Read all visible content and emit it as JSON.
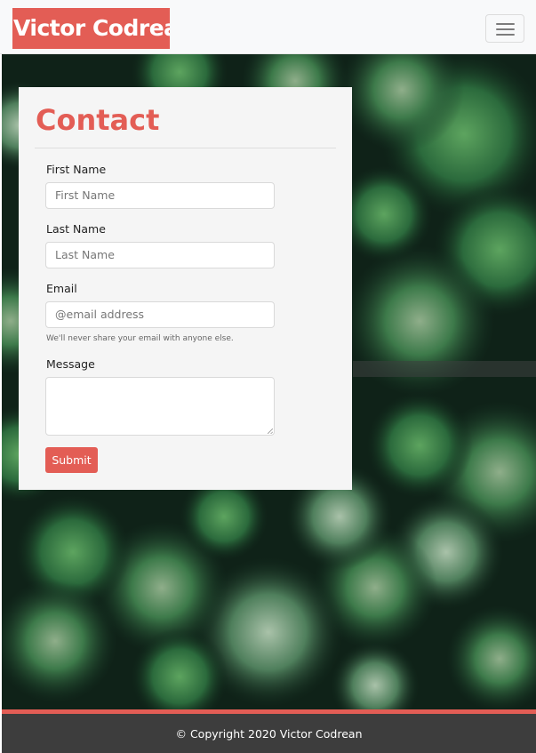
{
  "nav": {
    "brand": "Victor Codrean",
    "toggle_icon": "hamburger-menu-icon"
  },
  "hero": {
    "image_description_icon": "forest-aerial-image"
  },
  "contact": {
    "title": "Contact",
    "first_name": {
      "label": "First Name",
      "placeholder": "First Name"
    },
    "last_name": {
      "label": "Last Name",
      "placeholder": "Last Name"
    },
    "email": {
      "label": "Email",
      "placeholder": "@email address",
      "help": "We'll never share your email with anyone else."
    },
    "message": {
      "label": "Message"
    },
    "submit_label": "Submit"
  },
  "footer": {
    "copyright": "© Copyright 2020 Victor Codrean"
  },
  "colors": {
    "accent": "#e35d55",
    "navbar_bg": "#f8f9fa",
    "card_bg": "#f5f5f5",
    "footer_bg": "#3d3d3d"
  }
}
